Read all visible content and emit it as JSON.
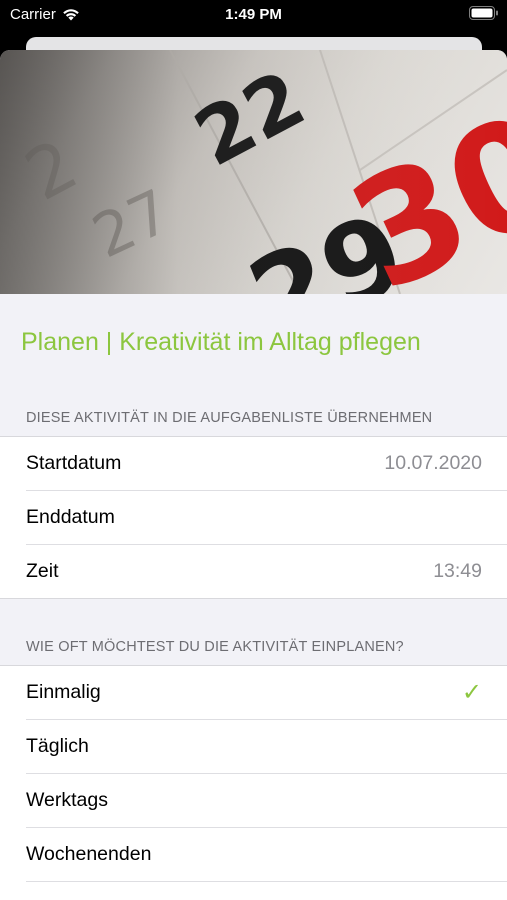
{
  "status_bar": {
    "carrier": "Carrier",
    "time": "1:49 PM",
    "wifi_icon": "wifi-icon",
    "battery_icon": "battery-icon"
  },
  "hero": {
    "image": "calendar-page-photo",
    "numbers": [
      "22",
      "30",
      "29",
      "27"
    ]
  },
  "title": "Planen | Kreativität im Alltag pflegen",
  "schedule": {
    "header": "DIESE AKTIVITÄT IN DIE AUFGABENLISTE ÜBERNEHMEN",
    "rows": [
      {
        "label": "Startdatum",
        "value": "10.07.2020"
      },
      {
        "label": "Enddatum",
        "value": ""
      },
      {
        "label": "Zeit",
        "value": "13:49"
      }
    ]
  },
  "frequency": {
    "header": "WIE OFT MÖCHTEST DU DIE AKTIVITÄT EINPLANEN?",
    "options": [
      {
        "label": "Einmalig",
        "selected": true
      },
      {
        "label": "Täglich",
        "selected": false
      },
      {
        "label": "Werktags",
        "selected": false
      },
      {
        "label": "Wochenenden",
        "selected": false
      }
    ],
    "check_glyph": "✓"
  },
  "colors": {
    "accent": "#8cc63f",
    "background": "#f2f2f7",
    "secondary_text": "#8e8e93"
  }
}
